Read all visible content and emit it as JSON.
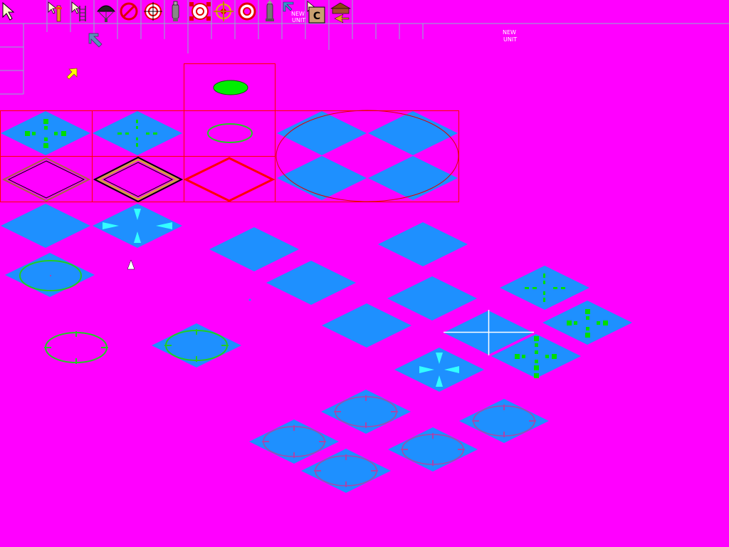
{
  "labels": {
    "toolbar_new_unit": [
      "NEW",
      "UNIT"
    ],
    "field_new_unit": [
      "NEW",
      "UNIT"
    ],
    "cancel_glyph": "C"
  },
  "colors": {
    "background": "#ff00ff",
    "tile": "#1e90ff",
    "grid": "#8ab4c8",
    "red_frame": "#ff0000",
    "marker_green": "#00dd00",
    "arrow_cyan": "#33ffff"
  },
  "toolbar_icons": [
    "select-cursor-icon",
    "cursor-flag-icon",
    "cursor-ladder-icon",
    "parachute-icon",
    "no-entry-icon",
    "crosshair-target-icon",
    "bomb-icon",
    "target-bracket-red-icon",
    "target-bracket-yellow-icon",
    "target-circle-red-icon",
    "missile-icon",
    "new-unit-icon",
    "cursor-cancel-icon",
    "house-arrow-icon"
  ],
  "sprites": [
    "move-arrow-icon",
    "yellow-arrow-icon",
    "white-pointer-icon"
  ]
}
